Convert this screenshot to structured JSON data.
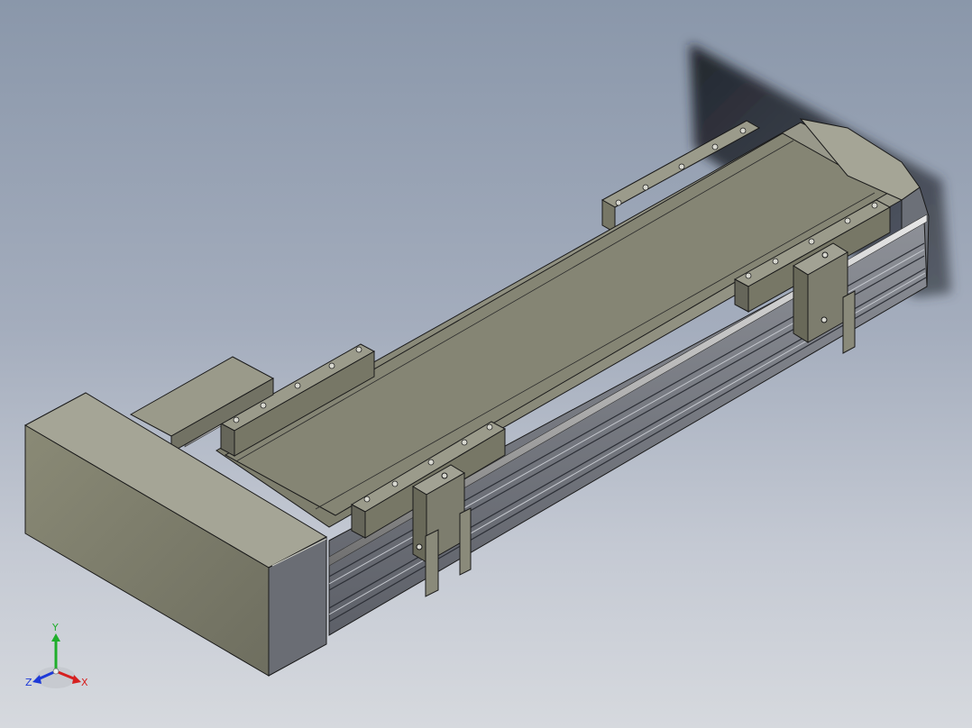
{
  "viewport": {
    "background_top": "#8a97aa",
    "background_bottom": "#d6d9de"
  },
  "triad": {
    "x_label": "X",
    "y_label": "Y",
    "z_label": "Z",
    "x_color": "#d62020",
    "y_color": "#1fae2b",
    "z_color": "#1e3ad8"
  },
  "model": {
    "body_color": "#8a8b78",
    "edge_color": "#1a1a1a"
  }
}
